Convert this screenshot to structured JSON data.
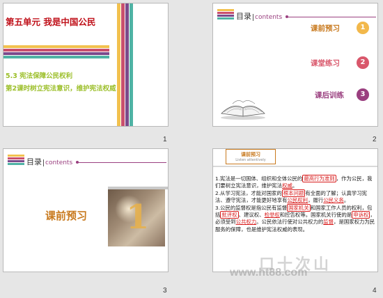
{
  "colors": {
    "red_title": "#c0121b",
    "green_text": "#9cbf2a",
    "orange": "#c8791d",
    "purple": "#9a3f7f",
    "pink": "#d9576b",
    "stripe_yellow": "#f2c14e",
    "stripe_teal": "#4fb3a5",
    "stripe_rose": "#c94f6d",
    "stripe_purple": "#7b4a8b"
  },
  "slide1": {
    "title": "第五单元 我是中国公民",
    "subtitle": "5.3 宪法保障公民权利",
    "lesson": "第2课时树立宪法意识，维护宪法权威",
    "number": "1"
  },
  "slide2": {
    "header": "目录",
    "header_en": "contents",
    "items": [
      {
        "label": "课前预习",
        "num": "1",
        "color": "#c8791d",
        "badge": "#f2b84b"
      },
      {
        "label": "课堂练习",
        "num": "2",
        "color": "#d9576b",
        "badge": "#d9576b"
      },
      {
        "label": "课后训练",
        "num": "3",
        "color": "#9a3f7f",
        "badge": "#9a3f7f"
      }
    ],
    "book_icon": "open-book-icon",
    "number": "2"
  },
  "slide3": {
    "header": "目录",
    "header_en": "contents",
    "title": "课前预习",
    "big_number": "1",
    "number": "3"
  },
  "slide4": {
    "tag_title": "课前预习",
    "tag_sub": "Listen attentively",
    "number": "4",
    "lines": {
      "p1a": "1.宪法是一切国体、组织和全体公民",
      "p1b": "的",
      "p1c": "最高行为准则",
      "p1d": "，作为公民，我们要树立宪法意识，维护宪法",
      "p1e": "权威",
      "p1f": "。",
      "p2a": "2.从学习宪法，才能对国家的",
      "p2b": "根本问题",
      "p2c": "有全面的了解；认真学习宪法、遵守宪法，才能更好地享有",
      "p2d": "公民权利",
      "p2e": "，履行",
      "p2f": "公民义务",
      "p2g": "。",
      "p3a": "3.公民的监督权是指公民有监督",
      "p3b": "国家机关",
      "p3c": "和国家工作人员的权利，包括",
      "p3d": "批评权",
      "p3e": "、建议权、",
      "p3f": "检举权",
      "p3g": "和控告权等。国家机关行使的是",
      "p3h": "申诉权",
      "p3i": "，必须受到",
      "p3j": "公共权力",
      "p3k": "。公民依法行使对公共权力的",
      "p3l": "监督",
      "p3m": "，是国家权力为民服务的保障，也是维护宪法权威的表现。"
    }
  },
  "watermark": {
    "url": "www.ht88.com",
    "cn": "口十次山"
  }
}
